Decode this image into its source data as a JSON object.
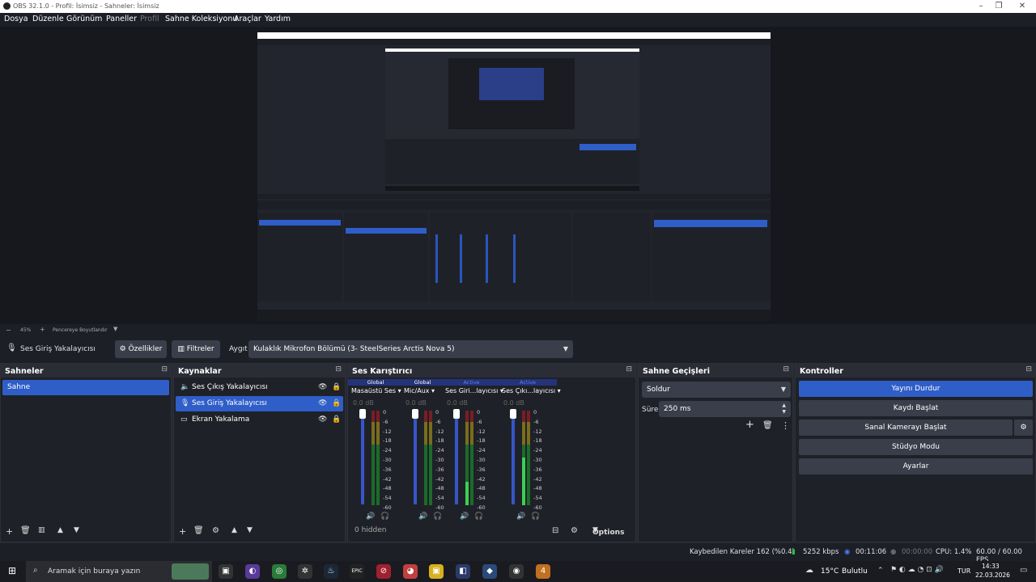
{
  "window": {
    "title": "OBS 32.1.0 - Profil: İsimsiz - Sahneler: İsimsiz"
  },
  "menu": [
    {
      "label": "Dosya"
    },
    {
      "label": "Düzenle"
    },
    {
      "label": "Görünüm"
    },
    {
      "label": "Paneller"
    },
    {
      "label": "Profil",
      "disabled": true
    },
    {
      "label": "Sahne Koleksiyonu"
    },
    {
      "label": "Araçlar"
    },
    {
      "label": "Yardım"
    }
  ],
  "preview_bar": {
    "zoom": "45%",
    "zoom_prefix": "−",
    "plus": "+",
    "fit_label": "Pencereye Boyutlandır"
  },
  "source_toolbar": {
    "source_name": "Ses Giriş Yakalayıcısı",
    "properties_label": "Özellikler",
    "filters_label": "Filtreler",
    "device_label": "Aygıt",
    "device_value": "Kulaklık Mikrofon Bölümü (3- SteelSeries Arctis Nova 5)"
  },
  "scenes": {
    "title": "Sahneler",
    "items": [
      "Sahne"
    ],
    "selected": 0
  },
  "sources": {
    "title": "Kaynaklar",
    "items": [
      {
        "label": "Ses Çıkış Yakalayıcısı",
        "icon": "speaker-icon"
      },
      {
        "label": "Ses Giriş Yakalayıcısı",
        "icon": "microphone-icon",
        "selected": true
      },
      {
        "label": "Ekran Yakalama",
        "icon": "monitor-icon"
      }
    ]
  },
  "mixer": {
    "title": "Ses Karıştırıcı",
    "channels": [
      {
        "tag": "Global",
        "name": "Masaüstü Ses",
        "db": "0.0 dB",
        "level": 0.0
      },
      {
        "tag": "Global",
        "name": "Mic/Aux",
        "db": "0.0 dB",
        "level": 0.0
      },
      {
        "tag": "Active",
        "name": "Ses Giri...layıcısı",
        "db": "0.0 dB",
        "level": 0.25
      },
      {
        "tag": "Active",
        "name": "Ses Çıkı...layıcısı",
        "db": "0.0 dB",
        "level": 0.5
      }
    ],
    "scale": [
      "0",
      "-6",
      "-12",
      "-18",
      "-24",
      "-30",
      "-36",
      "-42",
      "-48",
      "-54",
      "-60"
    ],
    "hidden_label": "0 hidden",
    "options_label": "Options"
  },
  "transitions": {
    "title": "Sahne Geçişleri",
    "type": "Soldur",
    "duration_label": "Süre",
    "duration_value": "250 ms"
  },
  "controls": {
    "title": "Kontroller",
    "buttons": [
      "Yayını Durdur",
      "Kaydı Başlat",
      "Sanal Kamerayı Başlat",
      "Stüdyo Modu",
      "Ayarlar"
    ]
  },
  "status": {
    "dropped": "Kaybedilen Kareler 162 (%0.4)",
    "bitrate": "5252 kbps",
    "stream_time": "00:11:06",
    "record_time": "00:00:00",
    "cpu": "CPU: 1.4%",
    "fps": "60.00 / 60.00 FPS"
  },
  "taskbar": {
    "search_placeholder": "Aramak için buraya yazın",
    "weather": "15°C",
    "weather_desc": "Bulutlu",
    "lang": "TUR",
    "time": "14:33",
    "date": "22.03.2026"
  },
  "colors": {
    "accent": "#2f5ec8",
    "bg": "#272a33",
    "panel": "#1f2128",
    "active_tag": "#5b7df0"
  }
}
